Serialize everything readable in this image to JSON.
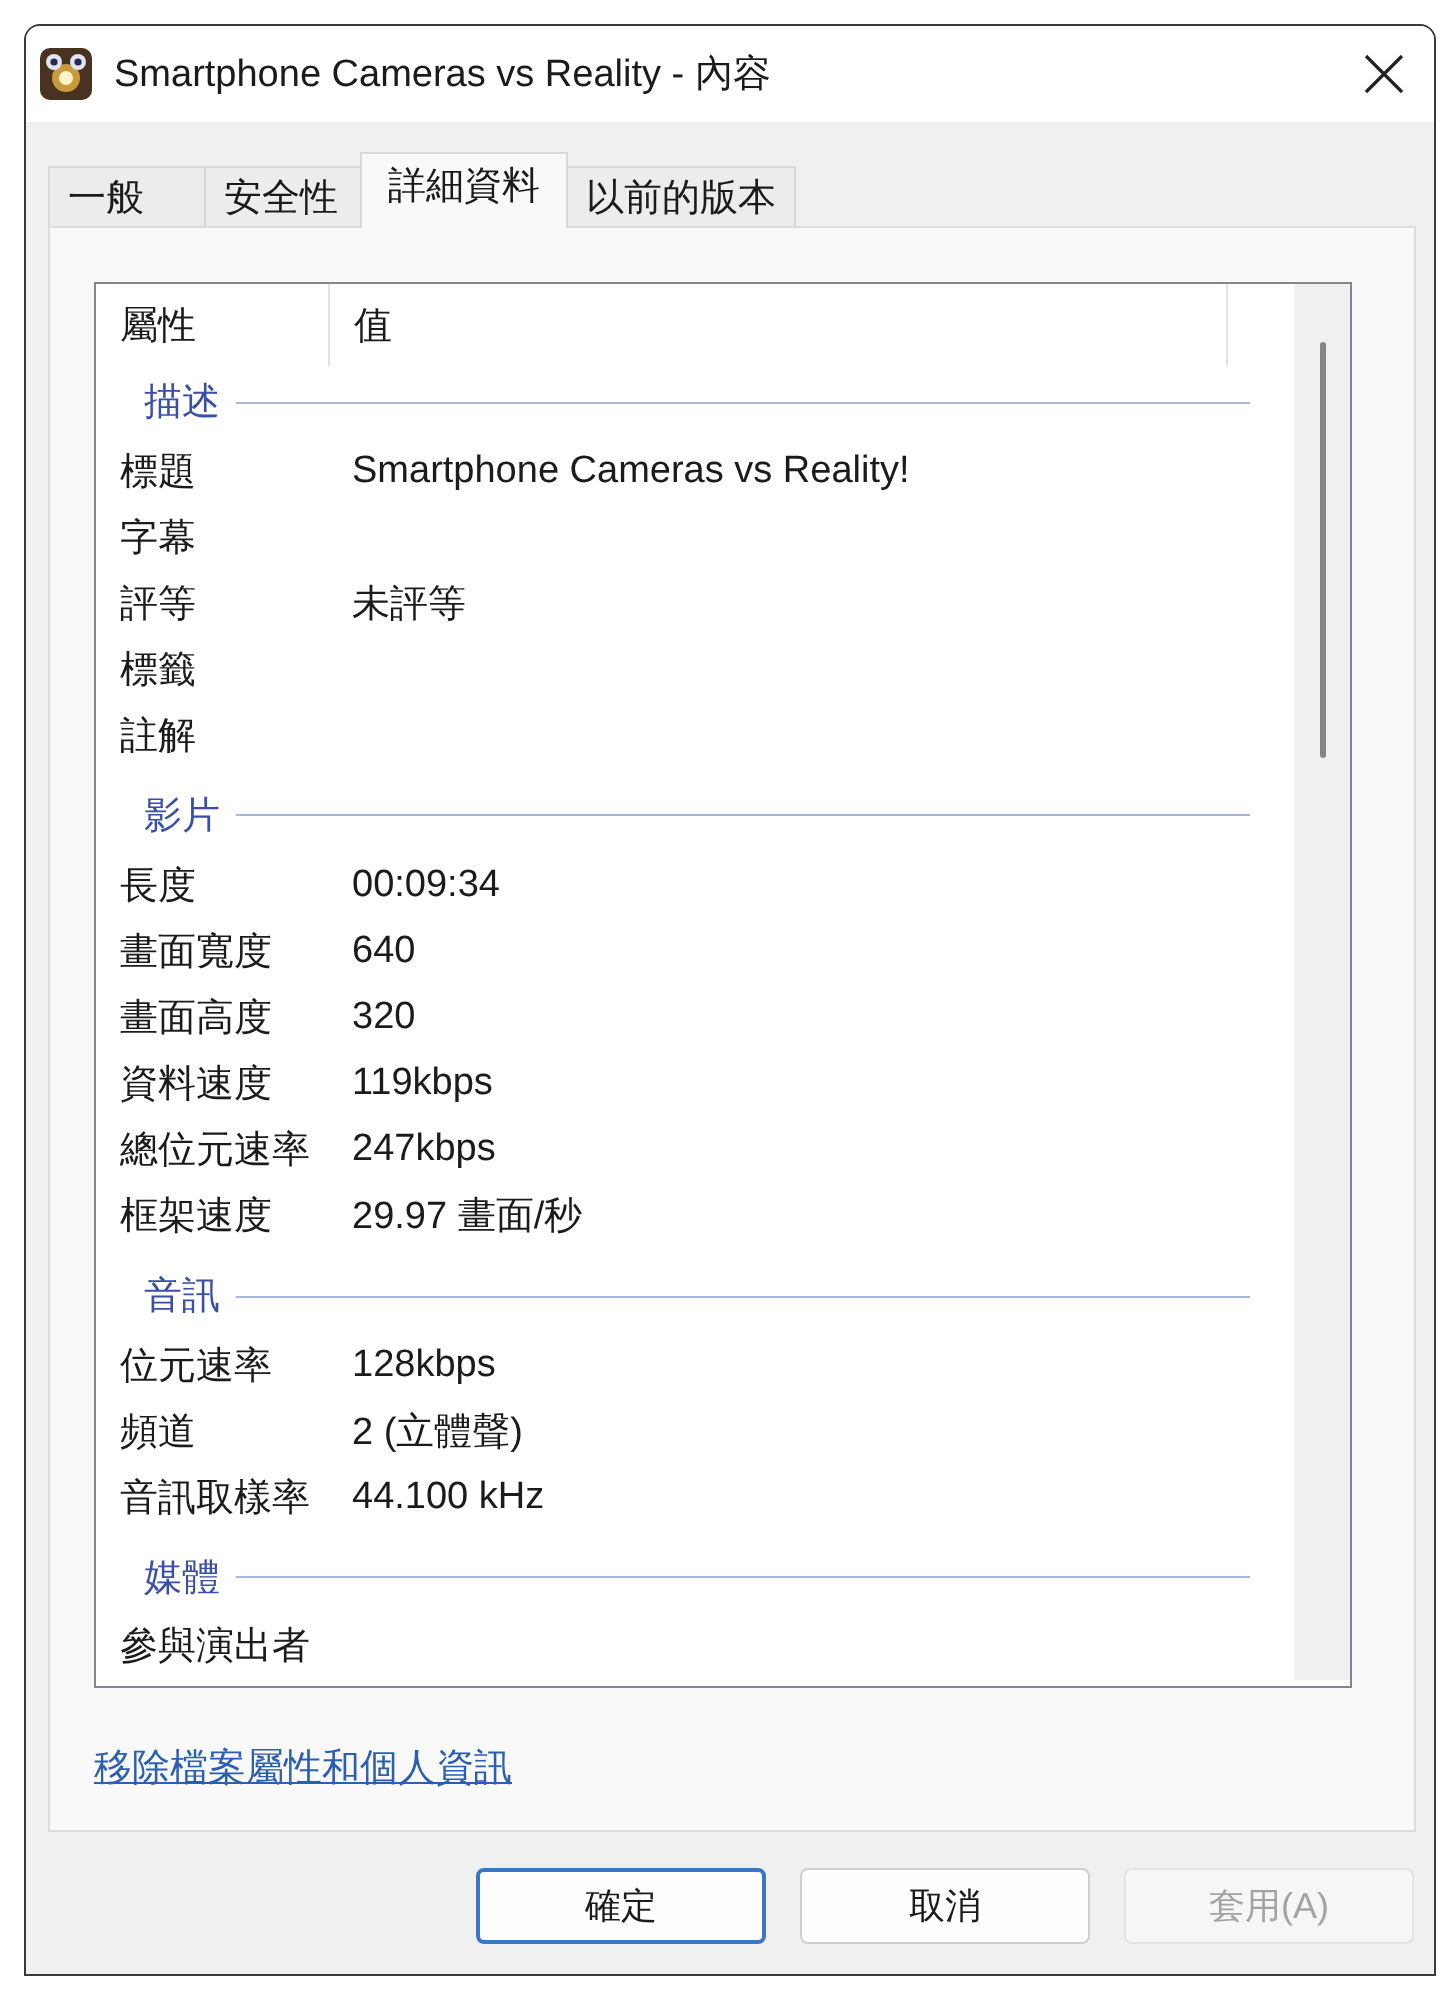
{
  "window": {
    "title": "Smartphone Cameras vs Reality - 內容"
  },
  "tabs": [
    {
      "label": "一般",
      "selected": false
    },
    {
      "label": "安全性",
      "selected": false
    },
    {
      "label": "詳細資料",
      "selected": true
    },
    {
      "label": "以前的版本",
      "selected": false
    }
  ],
  "property_list": {
    "columns": [
      "屬性",
      "值"
    ],
    "sections": [
      {
        "heading": "描述",
        "rows": [
          {
            "name": "標題",
            "value": "Smartphone Cameras vs Reality!"
          },
          {
            "name": "字幕"
          },
          {
            "name": "評等",
            "value": "未評等"
          },
          {
            "name": "標籤"
          },
          {
            "name": "註解"
          }
        ]
      },
      {
        "heading": "影片",
        "rows": [
          {
            "name": "長度",
            "value": "00:09:34"
          },
          {
            "name": "畫面寬度",
            "value": "640"
          },
          {
            "name": "畫面高度",
            "value": "320"
          },
          {
            "name": "資料速度",
            "value": "119kbps"
          },
          {
            "name": "總位元速率",
            "value": "247kbps"
          },
          {
            "name": "框架速度",
            "value": "29.97 畫面/秒"
          }
        ]
      },
      {
        "heading": "音訊",
        "rows": [
          {
            "name": "位元速率",
            "value": "128kbps"
          },
          {
            "name": "頻道",
            "value": "2 (立體聲)"
          },
          {
            "name": "音訊取樣率",
            "value": "44.100 kHz"
          }
        ]
      },
      {
        "heading": "媒體",
        "rows": [
          {
            "name": "參與演出者"
          }
        ]
      }
    ]
  },
  "remove_link": "移除檔案屬性和個人資訊",
  "buttons": [
    {
      "label": "確定",
      "default": true,
      "disabled": false
    },
    {
      "label": "取消",
      "default": false,
      "disabled": false
    },
    {
      "label": "套用(A)",
      "default": false,
      "disabled": true
    }
  ]
}
